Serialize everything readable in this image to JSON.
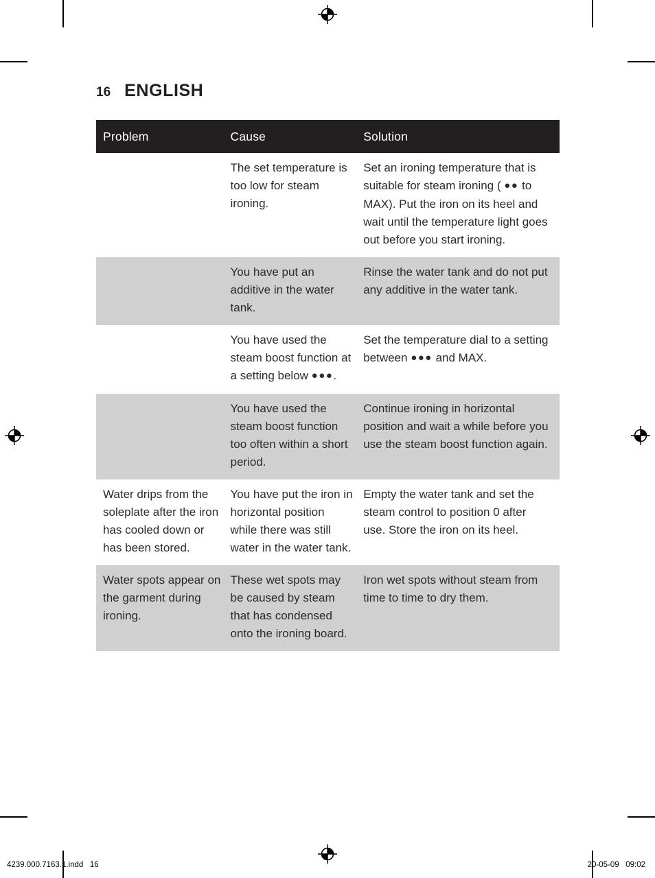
{
  "page": {
    "number": "16",
    "title": "ENGLISH"
  },
  "table": {
    "headers": {
      "problem": "Problem",
      "cause": "Cause",
      "solution": "Solution"
    },
    "rows": [
      {
        "shaded": false,
        "problem": "",
        "cause": "The set temperature is too low for steam ironing.",
        "solution_pre": "Set an ironing temperature that is suitable for steam ironing ( ",
        "solution_dots": "●●",
        "solution_post": " to MAX). Put the iron on its heel and wait until the temperature light goes out before you start ironing.",
        "cause_dots": "",
        "cause_post": ""
      },
      {
        "shaded": true,
        "problem": "",
        "cause": "You have put an additive in the water tank.",
        "solution_pre": "Rinse the water tank and do not put any additive in the water tank.",
        "solution_dots": "",
        "solution_post": "",
        "cause_dots": "",
        "cause_post": ""
      },
      {
        "shaded": false,
        "problem": "",
        "cause": "You have used the steam boost function at a setting below ",
        "cause_dots": "●●●",
        "cause_post": ".",
        "solution_pre": "Set the temperature dial to a setting between  ",
        "solution_dots": "●●●",
        "solution_post": " and MAX."
      },
      {
        "shaded": true,
        "problem": "",
        "cause": "You have used the steam boost function too often within a short period.",
        "solution_pre": "Continue ironing in horizontal position and wait a while before you use the steam boost function again.",
        "solution_dots": "",
        "solution_post": "",
        "cause_dots": "",
        "cause_post": ""
      },
      {
        "shaded": false,
        "problem": "Water drips from the soleplate after the iron has cooled down or has been stored.",
        "cause": "You have put the iron in horizontal position while there was still water in the water tank.",
        "solution_pre": "Empty the water tank and set the steam control to position 0 after use. Store the iron on its heel.",
        "solution_dots": "",
        "solution_post": "",
        "cause_dots": "",
        "cause_post": ""
      },
      {
        "shaded": true,
        "problem": "Water spots appear on the garment during ironing.",
        "cause": "These wet spots may be caused by steam that has condensed onto the ironing board.",
        "solution_pre": "Iron wet spots without steam from time to time to dry them.",
        "solution_dots": "",
        "solution_post": "",
        "cause_dots": "",
        "cause_post": ""
      }
    ]
  },
  "slug": {
    "left": "4239.000.7163.1.indd   16",
    "right": "20-05-09   09:02"
  },
  "colors": {
    "header_bar": "#231f20",
    "shaded_row": "#d0d0d0",
    "text": "#2b2b2b",
    "page_background": "#ffffff"
  },
  "marks": {
    "registration": "registration-target",
    "crop": "crop-mark"
  }
}
